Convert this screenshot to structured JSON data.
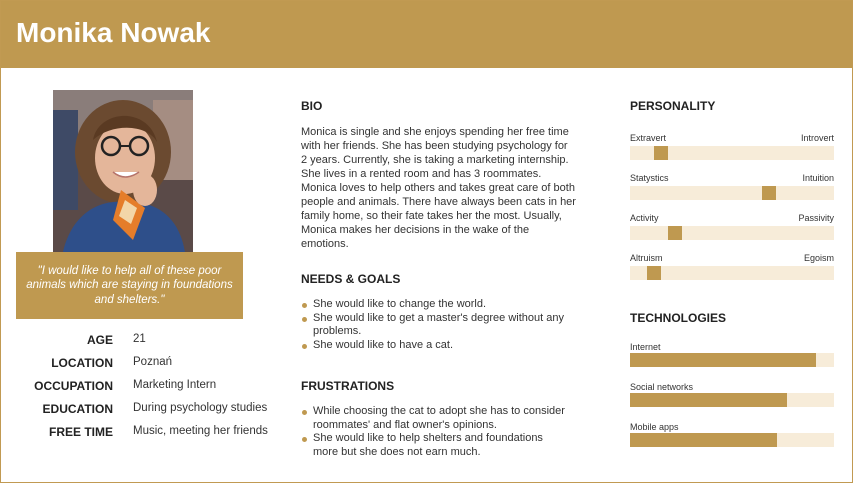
{
  "name": "Monika Nowak",
  "quote": "\"I would like to help all of these poor animals which are staying in foundations and shelters.\"",
  "facts": [
    {
      "label": "AGE",
      "value": "21"
    },
    {
      "label": "LOCATION",
      "value": "Poznań"
    },
    {
      "label": "OCCUPATION",
      "value": "Marketing Intern"
    },
    {
      "label": "EDUCATION",
      "value": "During psychology studies"
    },
    {
      "label": "FREE TIME",
      "value": "Music,  meeting her friends"
    }
  ],
  "bio": {
    "title": "BIO",
    "text": "Monica is single and she enjoys spending her free time with her friends. She has been studying psychology for 2 years. Currently, she is taking a marketing internship.  She lives in a rented room and has 3 roommates.  Monica loves to help others and takes great care of both people and animals. There have always been cats in her family home, so their fate takes her the most. Usually, Monica makes her decisions in the wake of the emotions."
  },
  "needs": {
    "title": "NEEDS & GOALS",
    "items": [
      "She would like to change the world.",
      "She would like to get a master's degree without any problems.",
      "She would like to have a cat."
    ]
  },
  "frustrations": {
    "title": "FRUSTRATIONS",
    "items": [
      "While choosing the cat to adopt she has to consider roommates' and flat owner's opinions.",
      "She would like to help shelters and foundations more but she does not earn much."
    ]
  },
  "personality": {
    "title": "PERSONALITY",
    "traits": [
      {
        "left": "Extravert",
        "right": "Introvert",
        "level": 0.15
      },
      {
        "left": "Statystics",
        "right": "Intuition",
        "level": 0.68
      },
      {
        "left": "Activity",
        "right": "Passivity",
        "level": 0.22
      },
      {
        "left": "Altruism",
        "right": "Egoism",
        "level": 0.12
      }
    ]
  },
  "technologies": {
    "title": "TECHNOLOGIES",
    "items": [
      {
        "label": "Internet",
        "level": 0.91
      },
      {
        "label": "Social networks",
        "level": 0.77
      },
      {
        "label": "Mobile apps",
        "level": 0.72
      }
    ]
  },
  "colors": {
    "accent": "#bf9950",
    "track": "#f7ecd9"
  },
  "photo_icon": "persona-photo"
}
